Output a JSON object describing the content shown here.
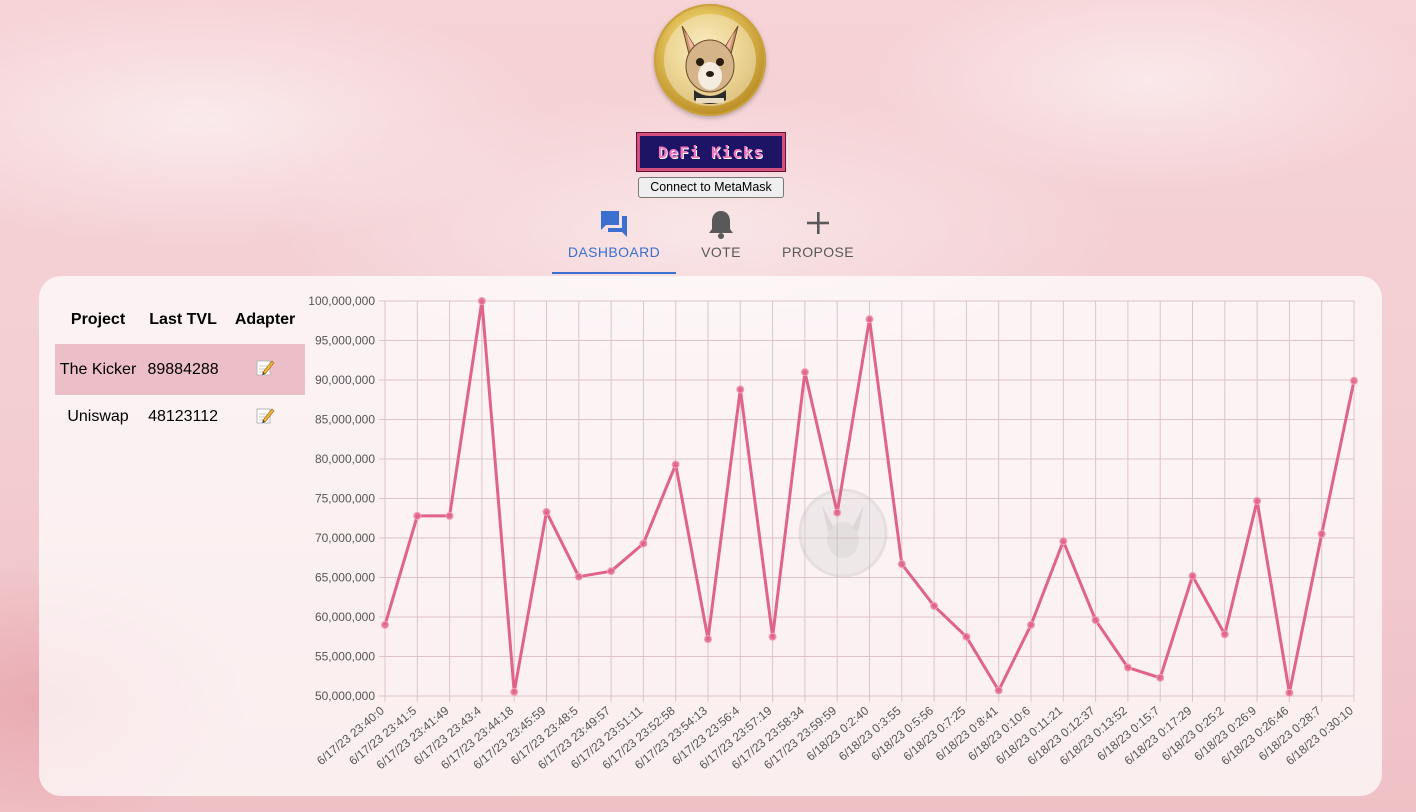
{
  "header": {
    "brand": "DeFi Kicks",
    "connect_label": "Connect to MetaMask"
  },
  "tabs": [
    {
      "label": "DASHBOARD",
      "icon": "forum-icon",
      "active": true
    },
    {
      "label": "VOTE",
      "icon": "bell-icon",
      "active": false
    },
    {
      "label": "PROPOSE",
      "icon": "plus-icon",
      "active": false
    }
  ],
  "colors": {
    "accent": "#3b6fd0",
    "line": "#e0648a",
    "highlight_row": "#ecbfc8"
  },
  "table": {
    "columns": [
      "Project",
      "Last TVL",
      "Adapter"
    ],
    "rows": [
      {
        "project": "The Kicker",
        "tvl": "89884288",
        "adapter": "edit-icon",
        "highlighted": true
      },
      {
        "project": "Uniswap",
        "tvl": "48123112",
        "adapter": "edit-icon",
        "highlighted": false
      }
    ]
  },
  "chart_data": {
    "type": "line",
    "title": "",
    "xlabel": "",
    "ylabel": "",
    "ylim": [
      50000000,
      100000000
    ],
    "y_ticks": [
      "50,000,000",
      "55,000,000",
      "60,000,000",
      "65,000,000",
      "70,000,000",
      "75,000,000",
      "80,000,000",
      "85,000,000",
      "90,000,000",
      "95,000,000",
      "100,000,000"
    ],
    "grid": true,
    "categories": [
      "6/17/23 23:40:0",
      "6/17/23 23:41:5",
      "6/17/23 23:41:49",
      "6/17/23 23:43:4",
      "6/17/23 23:44:18",
      "6/17/23 23:45:59",
      "6/17/23 23:48:5",
      "6/17/23 23:49:57",
      "6/17/23 23:51:11",
      "6/17/23 23:52:58",
      "6/17/23 23:54:13",
      "6/17/23 23:56:4",
      "6/17/23 23:57:19",
      "6/17/23 23:58:34",
      "6/17/23 23:59:59",
      "6/18/23 0:2:40",
      "6/18/23 0:3:55",
      "6/18/23 0:5:56",
      "6/18/23 0:7:25",
      "6/18/23 0:8:41",
      "6/18/23 0:10:6",
      "6/18/23 0:11:21",
      "6/18/23 0:12:37",
      "6/18/23 0:13:52",
      "6/18/23 0:15:7",
      "6/18/23 0:17:29",
      "6/18/23 0:25:2",
      "6/18/23 0:26:9",
      "6/18/23 0:26:46",
      "6/18/23 0:28:7",
      "6/18/23 0:30:10"
    ],
    "series": [
      {
        "values": [
          59000000,
          72800000,
          72800000,
          100000000,
          50500000,
          73300000,
          65100000,
          65800000,
          69300000,
          79300000,
          57200000,
          88800000,
          57500000,
          91000000,
          73200000,
          97700000,
          66700000,
          61400000,
          57500000,
          50700000,
          59000000,
          69600000,
          59600000,
          53600000,
          52300000,
          65200000,
          57800000,
          74700000,
          50400000,
          70500000,
          89900000
        ]
      }
    ]
  }
}
